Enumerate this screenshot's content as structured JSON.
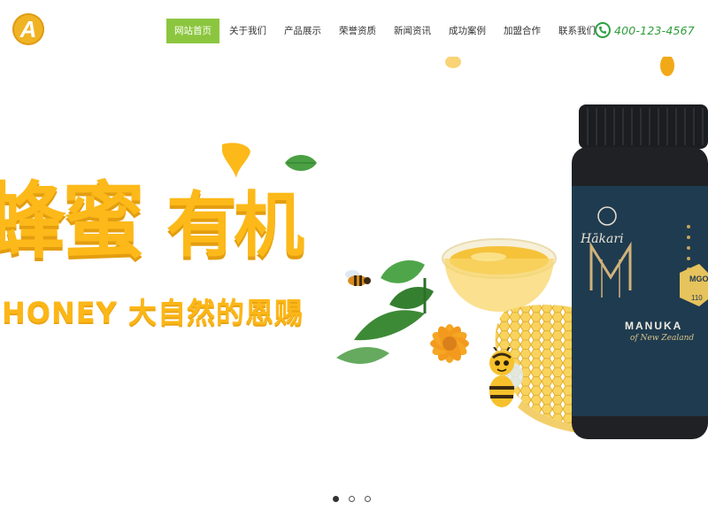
{
  "header": {
    "logo_letter": "A",
    "nav": [
      {
        "label": "网站首页",
        "active": true
      },
      {
        "label": "关于我们",
        "active": false
      },
      {
        "label": "产品展示",
        "active": false
      },
      {
        "label": "荣誉资质",
        "active": false
      },
      {
        "label": "新闻资讯",
        "active": false
      },
      {
        "label": "成功案例",
        "active": false
      },
      {
        "label": "加盟合作",
        "active": false
      },
      {
        "label": "联系我们",
        "active": false
      }
    ],
    "phone": "400-123-4567"
  },
  "banner": {
    "title_chars": [
      "蜂",
      "蜜",
      "有",
      "机"
    ],
    "subtitle": "HONEY 大自然的恩赐",
    "jar_brand": "Hākari",
    "jar_letter": "M",
    "jar_badge": "MGO",
    "jar_badge_num": "110",
    "jar_product": "MANUKA",
    "jar_origin": "of New Zealand",
    "slide_count": 3,
    "active_slide": 1
  },
  "colors": {
    "accent_green": "#8cc63f",
    "phone_green": "#2e9d3b",
    "honey_yellow": "#fcb919",
    "jar_navy": "#1f3b4f"
  }
}
